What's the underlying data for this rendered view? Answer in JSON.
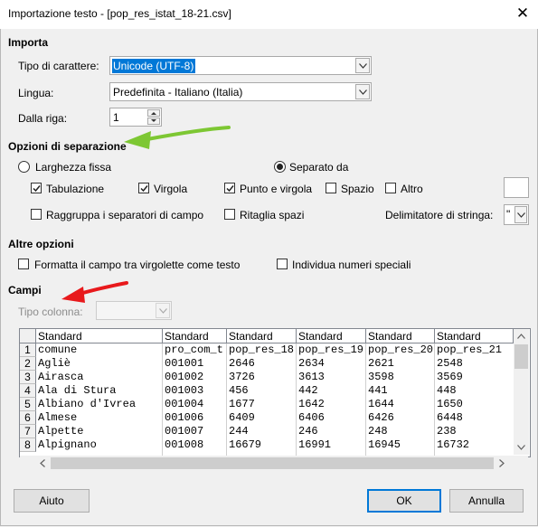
{
  "window": {
    "title": "Importazione testo - [pop_res_istat_18-21.csv]",
    "close_glyph": "✕"
  },
  "importa": {
    "heading": "Importa",
    "charset_label": "Tipo di carattere:",
    "charset_value": "Unicode (UTF-8)",
    "language_label": "Lingua:",
    "language_value": "Predefinita - Italiano (Italia)",
    "from_row_label": "Dalla riga:",
    "from_row_value": "1"
  },
  "separation": {
    "heading": "Opzioni di separazione",
    "fixed_width": "Larghezza fissa",
    "separated_by": "Separato da",
    "tab": "Tabulazione",
    "comma": "Virgola",
    "semicolon": "Punto e virgola",
    "space": "Spazio",
    "other": "Altro",
    "other_value": "",
    "merge": "Raggruppa i separatori di campo",
    "trim": "Ritaglia spazi",
    "string_delim_label": "Delimitatore di stringa:",
    "string_delim_value": "\"",
    "checked": {
      "tab": true,
      "comma": true,
      "semicolon": true,
      "space": false,
      "other": false,
      "merge": false,
      "trim": false
    },
    "selected_mode": "separated_by"
  },
  "other_options": {
    "heading": "Altre opzioni",
    "quoted_as_text": "Formatta il campo tra virgolette come testo",
    "detect_special": "Individua numeri speciali"
  },
  "fields": {
    "heading": "Campi",
    "column_type_label": "Tipo colonna:",
    "column_type_value": "",
    "headers": [
      "Standard",
      "Standard",
      "Standard",
      "Standard",
      "Standard",
      "Standard"
    ],
    "row_numbers": [
      "1",
      "2",
      "3",
      "4",
      "5",
      "6",
      "7",
      "8"
    ],
    "rows": [
      [
        "comune",
        "pro_com_t",
        "pop_res_18",
        "pop_res_19",
        "pop_res_20",
        "pop_res_21"
      ],
      [
        "Agliè",
        "001001",
        "2646",
        "2634",
        "2621",
        "2548"
      ],
      [
        "Airasca",
        "001002",
        "3726",
        "3613",
        "3598",
        "3569"
      ],
      [
        "Ala di Stura",
        "001003",
        "456",
        "442",
        "441",
        "448"
      ],
      [
        "Albiano d'Ivrea",
        "001004",
        "1677",
        "1642",
        "1644",
        "1650"
      ],
      [
        "Almese",
        "001006",
        "6409",
        "6406",
        "6426",
        "6448"
      ],
      [
        "Alpette",
        "001007",
        "244",
        "246",
        "248",
        "238"
      ],
      [
        "Alpignano",
        "001008",
        "16679",
        "16991",
        "16945",
        "16732"
      ]
    ]
  },
  "buttons": {
    "help": "Aiuto",
    "ok": "OK",
    "cancel": "Annulla"
  },
  "colors": {
    "selection": "#0078d7",
    "arrow_green": "#7dc733",
    "arrow_red": "#e8191c",
    "default_button_border": "#0078d7"
  }
}
